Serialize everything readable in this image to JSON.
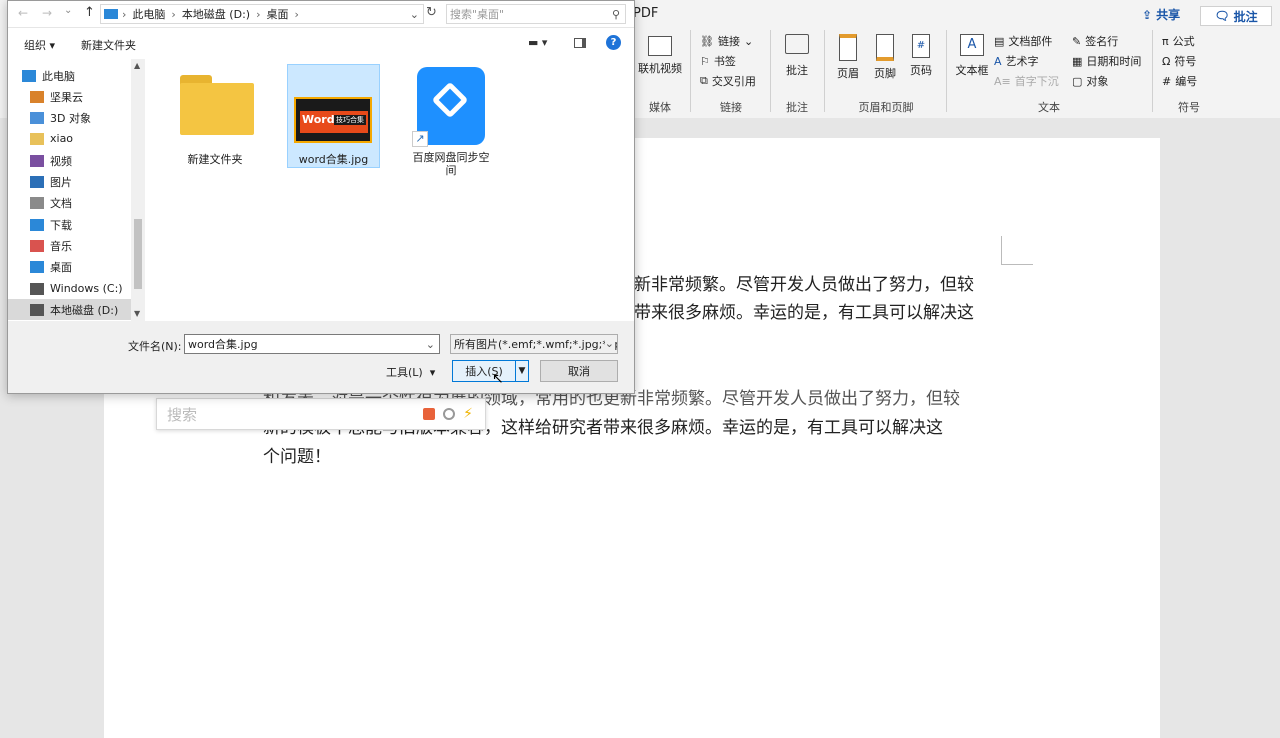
{
  "word": {
    "share_label": "共享",
    "comment_label": "批注",
    "pdf_fragment": "PDF",
    "ribbon": {
      "media": {
        "online_video": "联机视频",
        "group": "媒体"
      },
      "links": {
        "link": "链接",
        "bookmark": "书签",
        "cross_ref": "交叉引用",
        "group": "链接"
      },
      "comments": {
        "comment": "批注",
        "group": "批注"
      },
      "header_footer": {
        "header": "页眉",
        "footer": "页脚",
        "page_number": "页码",
        "group": "页眉和页脚"
      },
      "text": {
        "textbox": "文本框",
        "quick_parts": "文档部件",
        "wordart": "艺术字",
        "dropcap": "首字下沉",
        "signature": "签名行",
        "datetime": "日期和时间",
        "object": "对象",
        "group": "文本"
      },
      "symbols": {
        "equation": "公式",
        "symbol": "符号",
        "numbering": "编号",
        "group": "符号"
      }
    },
    "document": {
      "para1_line1": "新非常频繁。尽管开发人员做出了努力，但较",
      "para1_line2": "带来很多麻烦。幸运的是，有工具可以解决这",
      "para2_line1": "和发表，对是一个性很为展的领域，常用的也更新非常频繁。尽管开发人员做出了努力，但较",
      "para2_line2": "新的模板不总能与旧版本兼容，这样给研究者带来很多麻烦。幸运的是，有工具可以解决这",
      "para2_line3": "个问题！"
    },
    "search_overlay_placeholder": "搜索"
  },
  "dialog": {
    "breadcrumb": [
      "此电脑",
      "本地磁盘 (D:)",
      "桌面"
    ],
    "search_placeholder": "搜索\"桌面\"",
    "toolbar": {
      "organize": "组织",
      "new_folder": "新建文件夹"
    },
    "nav_items": [
      {
        "label": "此电脑",
        "icon": "computer-icon",
        "color": "#2b88d8"
      },
      {
        "label": "坚果云",
        "icon": "nut-icon",
        "color": "#d9822b"
      },
      {
        "label": "3D 对象",
        "icon": "cube-icon",
        "color": "#4a90d9"
      },
      {
        "label": "xiao",
        "icon": "folder-icon",
        "color": "#e8c15a"
      },
      {
        "label": "视频",
        "icon": "video-icon",
        "color": "#7a4fa0"
      },
      {
        "label": "图片",
        "icon": "picture-icon",
        "color": "#2b6fb7"
      },
      {
        "label": "文档",
        "icon": "document-icon",
        "color": "#8a8a8a"
      },
      {
        "label": "下载",
        "icon": "download-icon",
        "color": "#2b88d8"
      },
      {
        "label": "音乐",
        "icon": "music-icon",
        "color": "#d9534f"
      },
      {
        "label": "桌面",
        "icon": "desktop-icon",
        "color": "#2b88d8"
      },
      {
        "label": "Windows (C:)",
        "icon": "drive-icon",
        "color": "#555555"
      },
      {
        "label": "本地磁盘 (D:)",
        "icon": "drive-icon",
        "color": "#555555"
      }
    ],
    "files": [
      {
        "name": "新建文件夹",
        "type": "folder"
      },
      {
        "name": "word合集.jpg",
        "type": "image",
        "thumb_text": "Word",
        "thumb_sub": "技巧合集"
      },
      {
        "name": "百度网盘同步空间",
        "type": "shortcut"
      }
    ],
    "filename_label": "文件名(N):",
    "filename_value": "word合集.jpg",
    "filetype_value": "所有图片(*.emf;*.wmf;*.jpg;*.jp",
    "tools_label": "工具(L)",
    "insert_label": "插入(S)",
    "cancel_label": "取消"
  },
  "colors": {
    "accent": "#0078d7",
    "selected_bg": "#cce8ff",
    "folder": "#f4c542",
    "baidu": "#1e90ff"
  }
}
